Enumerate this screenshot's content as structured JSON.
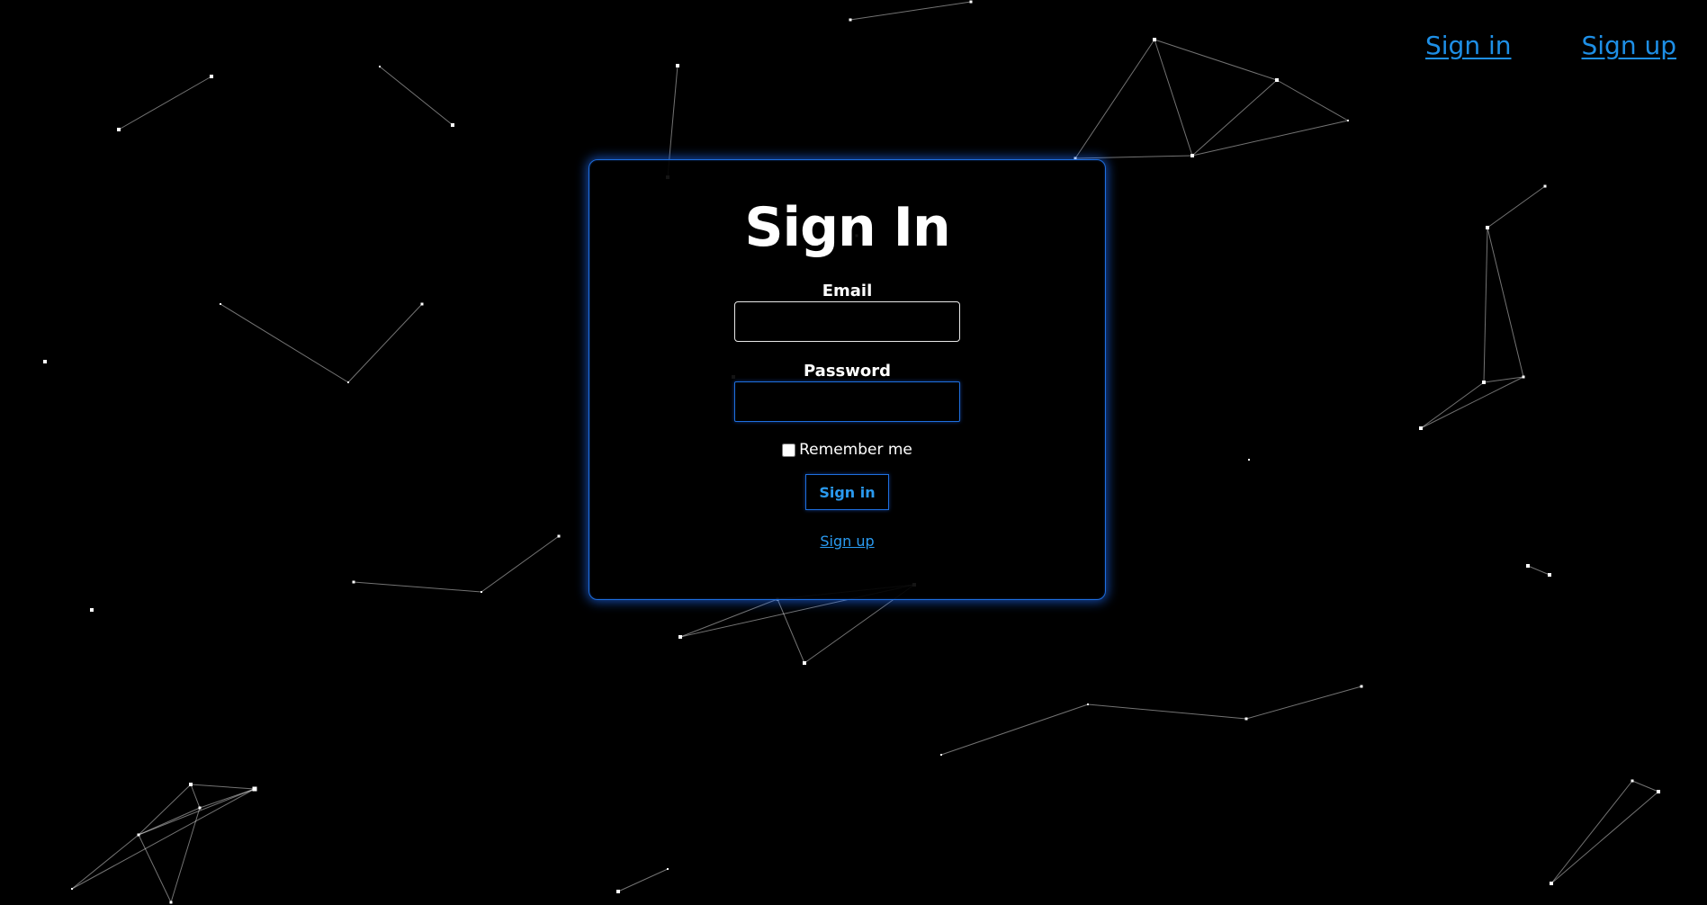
{
  "nav": {
    "sign_in": "Sign in",
    "sign_up": "Sign up"
  },
  "form": {
    "title": "Sign In",
    "email_label": "Email",
    "email_value": "",
    "password_label": "Password",
    "password_value": "",
    "remember_label": "Remember me",
    "remember_checked": false,
    "submit_label": "Sign in",
    "signup_link": "Sign up"
  },
  "colors": {
    "background": "#000000",
    "accent": "#1e8fe6",
    "card_border": "#1e6fe0",
    "particles": "#ffffff"
  }
}
